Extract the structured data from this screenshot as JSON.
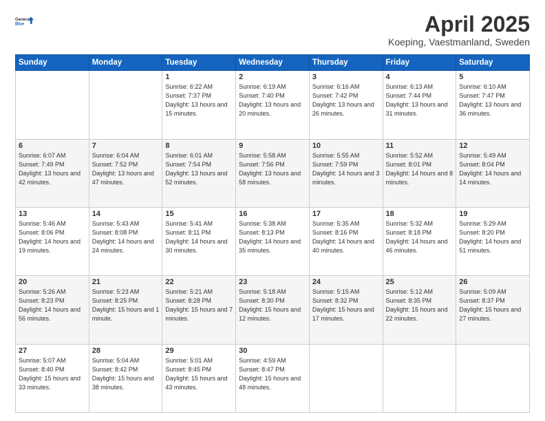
{
  "header": {
    "logo_general": "General",
    "logo_blue": "Blue",
    "main_title": "April 2025",
    "subtitle": "Koeping, Vaestmanland, Sweden"
  },
  "weekdays": [
    "Sunday",
    "Monday",
    "Tuesday",
    "Wednesday",
    "Thursday",
    "Friday",
    "Saturday"
  ],
  "weeks": [
    [
      {
        "day": "",
        "info": ""
      },
      {
        "day": "",
        "info": ""
      },
      {
        "day": "1",
        "info": "Sunrise: 6:22 AM\nSunset: 7:37 PM\nDaylight: 13 hours and 15 minutes."
      },
      {
        "day": "2",
        "info": "Sunrise: 6:19 AM\nSunset: 7:40 PM\nDaylight: 13 hours and 20 minutes."
      },
      {
        "day": "3",
        "info": "Sunrise: 6:16 AM\nSunset: 7:42 PM\nDaylight: 13 hours and 26 minutes."
      },
      {
        "day": "4",
        "info": "Sunrise: 6:13 AM\nSunset: 7:44 PM\nDaylight: 13 hours and 31 minutes."
      },
      {
        "day": "5",
        "info": "Sunrise: 6:10 AM\nSunset: 7:47 PM\nDaylight: 13 hours and 36 minutes."
      }
    ],
    [
      {
        "day": "6",
        "info": "Sunrise: 6:07 AM\nSunset: 7:49 PM\nDaylight: 13 hours and 42 minutes."
      },
      {
        "day": "7",
        "info": "Sunrise: 6:04 AM\nSunset: 7:52 PM\nDaylight: 13 hours and 47 minutes."
      },
      {
        "day": "8",
        "info": "Sunrise: 6:01 AM\nSunset: 7:54 PM\nDaylight: 13 hours and 52 minutes."
      },
      {
        "day": "9",
        "info": "Sunrise: 5:58 AM\nSunset: 7:56 PM\nDaylight: 13 hours and 58 minutes."
      },
      {
        "day": "10",
        "info": "Sunrise: 5:55 AM\nSunset: 7:59 PM\nDaylight: 14 hours and 3 minutes."
      },
      {
        "day": "11",
        "info": "Sunrise: 5:52 AM\nSunset: 8:01 PM\nDaylight: 14 hours and 8 minutes."
      },
      {
        "day": "12",
        "info": "Sunrise: 5:49 AM\nSunset: 8:04 PM\nDaylight: 14 hours and 14 minutes."
      }
    ],
    [
      {
        "day": "13",
        "info": "Sunrise: 5:46 AM\nSunset: 8:06 PM\nDaylight: 14 hours and 19 minutes."
      },
      {
        "day": "14",
        "info": "Sunrise: 5:43 AM\nSunset: 8:08 PM\nDaylight: 14 hours and 24 minutes."
      },
      {
        "day": "15",
        "info": "Sunrise: 5:41 AM\nSunset: 8:11 PM\nDaylight: 14 hours and 30 minutes."
      },
      {
        "day": "16",
        "info": "Sunrise: 5:38 AM\nSunset: 8:13 PM\nDaylight: 14 hours and 35 minutes."
      },
      {
        "day": "17",
        "info": "Sunrise: 5:35 AM\nSunset: 8:16 PM\nDaylight: 14 hours and 40 minutes."
      },
      {
        "day": "18",
        "info": "Sunrise: 5:32 AM\nSunset: 8:18 PM\nDaylight: 14 hours and 46 minutes."
      },
      {
        "day": "19",
        "info": "Sunrise: 5:29 AM\nSunset: 8:20 PM\nDaylight: 14 hours and 51 minutes."
      }
    ],
    [
      {
        "day": "20",
        "info": "Sunrise: 5:26 AM\nSunset: 8:23 PM\nDaylight: 14 hours and 56 minutes."
      },
      {
        "day": "21",
        "info": "Sunrise: 5:23 AM\nSunset: 8:25 PM\nDaylight: 15 hours and 1 minute."
      },
      {
        "day": "22",
        "info": "Sunrise: 5:21 AM\nSunset: 8:28 PM\nDaylight: 15 hours and 7 minutes."
      },
      {
        "day": "23",
        "info": "Sunrise: 5:18 AM\nSunset: 8:30 PM\nDaylight: 15 hours and 12 minutes."
      },
      {
        "day": "24",
        "info": "Sunrise: 5:15 AM\nSunset: 8:32 PM\nDaylight: 15 hours and 17 minutes."
      },
      {
        "day": "25",
        "info": "Sunrise: 5:12 AM\nSunset: 8:35 PM\nDaylight: 15 hours and 22 minutes."
      },
      {
        "day": "26",
        "info": "Sunrise: 5:09 AM\nSunset: 8:37 PM\nDaylight: 15 hours and 27 minutes."
      }
    ],
    [
      {
        "day": "27",
        "info": "Sunrise: 5:07 AM\nSunset: 8:40 PM\nDaylight: 15 hours and 33 minutes."
      },
      {
        "day": "28",
        "info": "Sunrise: 5:04 AM\nSunset: 8:42 PM\nDaylight: 15 hours and 38 minutes."
      },
      {
        "day": "29",
        "info": "Sunrise: 5:01 AM\nSunset: 8:45 PM\nDaylight: 15 hours and 43 minutes."
      },
      {
        "day": "30",
        "info": "Sunrise: 4:59 AM\nSunset: 8:47 PM\nDaylight: 15 hours and 48 minutes."
      },
      {
        "day": "",
        "info": ""
      },
      {
        "day": "",
        "info": ""
      },
      {
        "day": "",
        "info": ""
      }
    ]
  ]
}
